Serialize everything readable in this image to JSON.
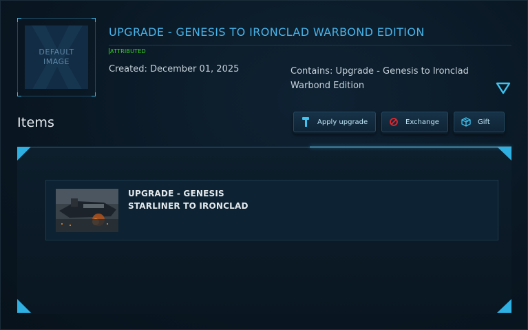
{
  "pledge": {
    "thumbnail_text": "DEFAULT IMAGE",
    "title": "UPGRADE - GENESIS TO IRONCLAD WARBOND EDITION",
    "status": "ATTRIBUTED",
    "created": "Created: December 01, 2025",
    "contains": "Contains: Upgrade - Genesis to Ironclad Warbond Edition",
    "expand_icon": "chevron-down-icon"
  },
  "items_section": {
    "heading": "Items",
    "buttons": {
      "apply_upgrade": "Apply upgrade",
      "exchange": "Exchange",
      "gift": "Gift"
    }
  },
  "items": [
    {
      "title": "UPGRADE - GENESIS STARLINER TO IRONCLAD"
    }
  ],
  "colors": {
    "accent": "#47b4ea",
    "status_green": "#38d62b",
    "background": "#09151f"
  }
}
